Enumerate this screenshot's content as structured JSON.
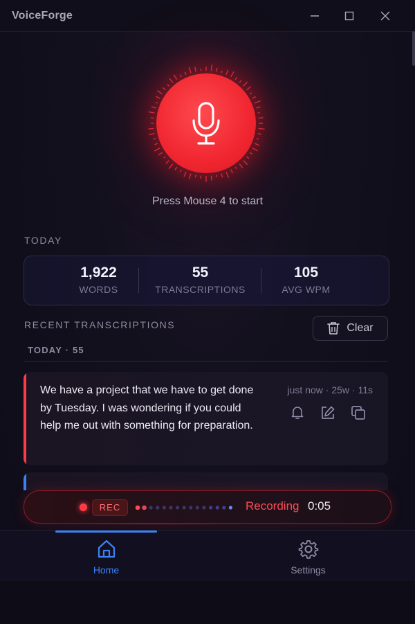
{
  "app": {
    "title": "VoiceForge"
  },
  "window_controls": {
    "minimize": "minimize-icon",
    "maximize": "maximize-icon",
    "close": "close-icon"
  },
  "mic": {
    "icon": "microphone-icon",
    "hint": "Press Mouse 4 to start",
    "accent": "#f02630"
  },
  "today": {
    "label": "TODAY",
    "stats": [
      {
        "value": "1,922",
        "label": "WORDS"
      },
      {
        "value": "55",
        "label": "TRANSCRIPTIONS"
      },
      {
        "value": "105",
        "label": "AVG WPM"
      }
    ]
  },
  "recent": {
    "label": "RECENT TRANSCRIPTIONS",
    "clear_label": "Clear",
    "group_label": "TODAY · 55",
    "items": [
      {
        "text": "We have a project that we have to get done by Tuesday. I was wondering if you could help me out with something for preparation.",
        "meta": "just now · 25w · 11s",
        "accent": "#ff3b45"
      },
      {
        "text": "",
        "meta": "",
        "accent": "#3b82f6"
      }
    ]
  },
  "recording": {
    "badge": "REC",
    "status": "Recording",
    "time": "0:05",
    "accent": "#ff3b45"
  },
  "nav": {
    "items": [
      {
        "label": "Home",
        "icon": "home-icon",
        "active": true
      },
      {
        "label": "Settings",
        "icon": "gear-icon",
        "active": false
      }
    ],
    "active_color": "#3b82f6"
  }
}
